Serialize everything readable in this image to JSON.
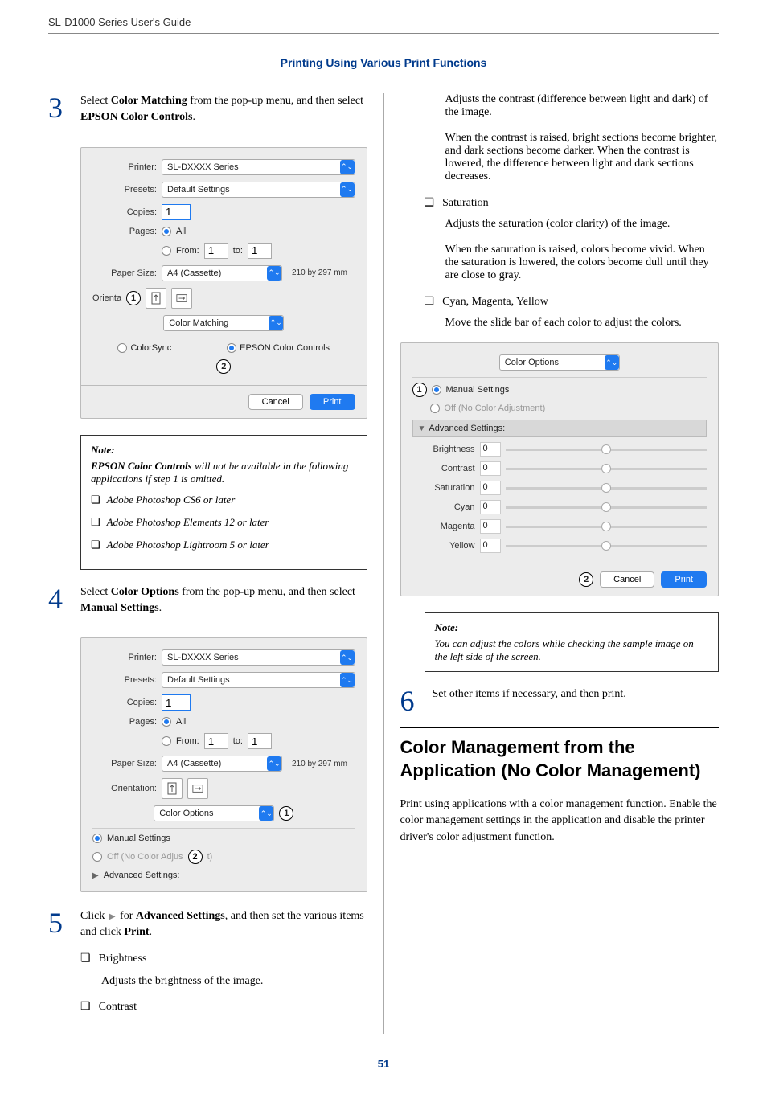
{
  "header": {
    "guide_title": "SL-D1000 Series User's Guide",
    "section_title": "Printing Using Various Print Functions"
  },
  "left": {
    "step3": {
      "num": "3",
      "text_pre": "Select ",
      "text_b1": "Color Matching",
      "text_mid": " from the pop-up menu, and then select ",
      "text_b2": "EPSON Color Controls",
      "text_post": "."
    },
    "dlg1": {
      "printer_label": "Printer:",
      "printer_value": "SL-DXXXX Series",
      "presets_label": "Presets:",
      "presets_value": "Default Settings",
      "copies_label": "Copies:",
      "copies_value": "1",
      "pages_label": "Pages:",
      "pages_all": "All",
      "pages_from": "From:",
      "pages_from_val": "1",
      "pages_to": "to:",
      "pages_to_val": "1",
      "papersize_label": "Paper Size:",
      "papersize_value": "A4 (Cassette)",
      "papersize_note": "210 by 297 mm",
      "orient_label": "Orienta",
      "callout1": "1",
      "menu_value": "Color Matching",
      "colorsync": "ColorSync",
      "epson_cc": "EPSON Color Controls",
      "callout2": "2",
      "cancel": "Cancel",
      "print": "Print"
    },
    "note1": {
      "title": "Note:",
      "lead_b": "EPSON Color Controls",
      "lead_rest": " will not be available in the following applications if step 1 is omitted.",
      "li1": "Adobe Photoshop CS6 or later",
      "li2": "Adobe Photoshop Elements 12 or later",
      "li3": "Adobe Photoshop Lightroom 5 or later"
    },
    "step4": {
      "num": "4",
      "text_pre": "Select ",
      "text_b1": "Color Options",
      "text_mid": " from the pop-up menu, and then select ",
      "text_b2": "Manual Settings",
      "text_post": "."
    },
    "dlg2": {
      "printer_label": "Printer:",
      "printer_value": "SL-DXXXX Series",
      "presets_label": "Presets:",
      "presets_value": "Default Settings",
      "copies_label": "Copies:",
      "copies_value": "1",
      "pages_label": "Pages:",
      "pages_all": "All",
      "pages_from": "From:",
      "pages_from_val": "1",
      "pages_to": "to:",
      "pages_to_val": "1",
      "papersize_label": "Paper Size:",
      "papersize_value": "A4 (Cassette)",
      "papersize_note": "210 by 297 mm",
      "orient_label": "Orientation:",
      "menu_value": "Color Options",
      "callout1": "1",
      "manual": "Manual Settings",
      "off_adj": "Off (No Color Adjus",
      "off_adj_tail": "t)",
      "callout2": "2",
      "adv": "Advanced Settings:"
    },
    "step5": {
      "num": "5",
      "text_pre": "Click ",
      "text_mid": " for ",
      "text_b1": "Advanced Settings",
      "text_mid2": ", and then set the various items and click ",
      "text_b2": "Print",
      "text_post": "."
    },
    "items5": {
      "li1": "Brightness",
      "li1_body": "Adjusts the brightness of the image.",
      "li2": "Contrast"
    }
  },
  "right": {
    "contrast_p1": "Adjusts the contrast (difference between light and dark) of the image.",
    "contrast_p2": "When the contrast is raised, bright sections become brighter, and dark sections become darker. When the contrast is lowered, the difference between light and dark sections decreases.",
    "sat_h": "Saturation",
    "sat_p1": "Adjusts the saturation (color clarity) of the image.",
    "sat_p2": "When the saturation is raised, colors become vivid. When the saturation is lowered, the colors become dull until they are close to gray.",
    "cmy_h": "Cyan, Magenta, Yellow",
    "cmy_p": "Move the slide bar of each color to adjust the colors.",
    "dlg3": {
      "menu_value": "Color Options",
      "callout1": "1",
      "manual": "Manual Settings",
      "off_adj": "Off (No Color Adjustment)",
      "adv": "Advanced Settings:",
      "labels": {
        "brightness": "Brightness",
        "contrast": "Contrast",
        "saturation": "Saturation",
        "cyan": "Cyan",
        "magenta": "Magenta",
        "yellow": "Yellow"
      },
      "val": "0",
      "callout2": "2",
      "cancel": "Cancel",
      "print": "Print"
    },
    "note2": {
      "title": "Note:",
      "body": "You can adjust the colors while checking the sample image on the left side of the screen."
    },
    "step6": {
      "num": "6",
      "text": "Set other items if necessary, and then print."
    },
    "h2": "Color Management from the Application (No Color Management)",
    "p_cm": "Print using applications with a color management function. Enable the color management settings in the application and disable the printer driver's color adjustment function."
  },
  "pagenum": "51"
}
